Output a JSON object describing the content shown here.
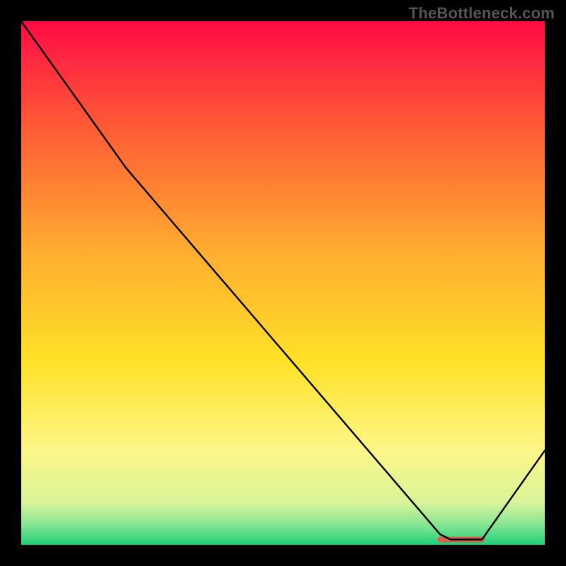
{
  "watermark": "TheBottleneck.com",
  "chart_data": {
    "type": "line",
    "title": "",
    "xlabel": "",
    "ylabel": "",
    "xlim": [
      0,
      100
    ],
    "ylim": [
      0,
      100
    ],
    "grid": false,
    "legend": false,
    "series": [
      {
        "name": "curve",
        "x": [
          0,
          20,
          80,
          82,
          88,
          100
        ],
        "values": [
          100,
          72,
          2,
          1,
          1,
          18
        ]
      }
    ],
    "marker_band": {
      "x_start": 80,
      "x_end": 88,
      "y": 1,
      "color": "#d9604c"
    },
    "gradient_stops": [
      {
        "offset": 0.0,
        "color": "#ff0b45"
      },
      {
        "offset": 0.2,
        "color": "#ff5a36"
      },
      {
        "offset": 0.45,
        "color": "#ffb030"
      },
      {
        "offset": 0.65,
        "color": "#ffe127"
      },
      {
        "offset": 0.82,
        "color": "#fdf788"
      },
      {
        "offset": 0.92,
        "color": "#d8f49a"
      },
      {
        "offset": 0.96,
        "color": "#8be694"
      },
      {
        "offset": 1.0,
        "color": "#21d07a"
      }
    ]
  }
}
